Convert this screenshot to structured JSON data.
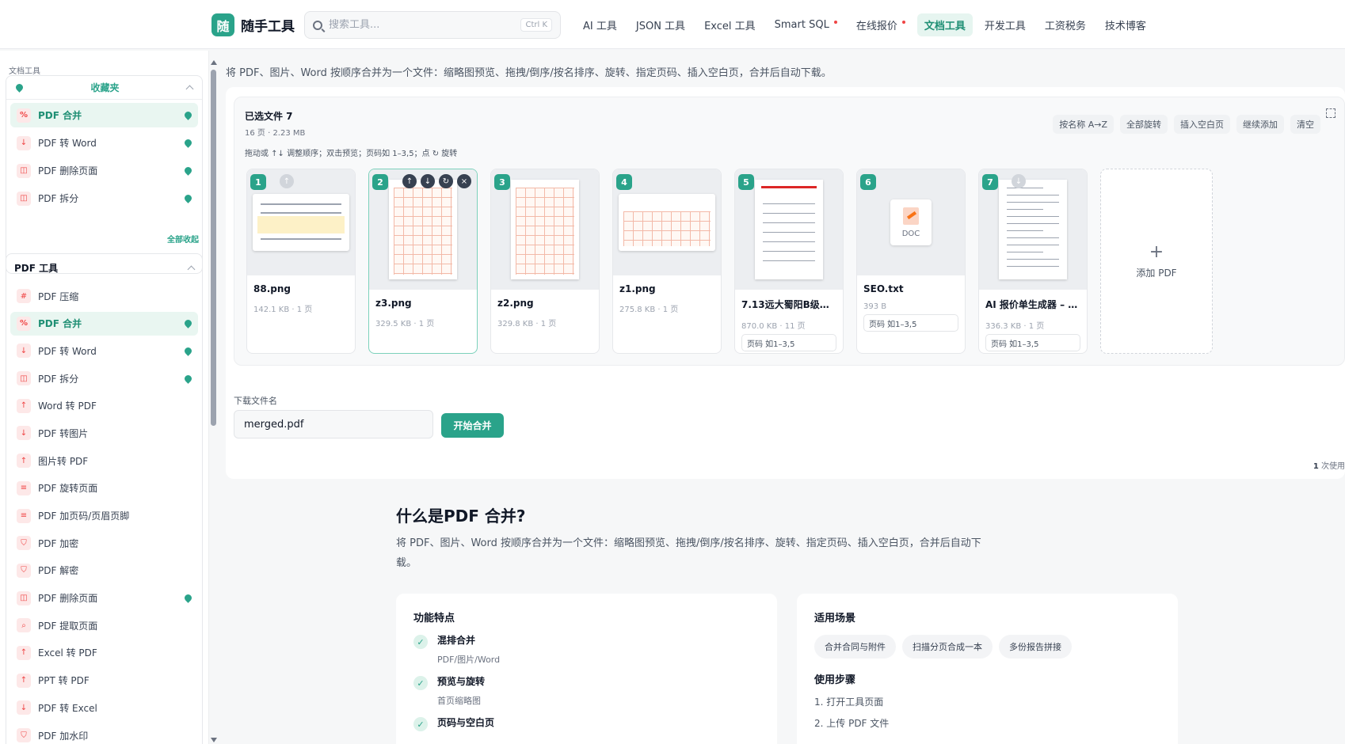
{
  "header": {
    "logo_mark": "随",
    "logo_text": "随手工具",
    "search_placeholder": "搜索工具...",
    "search_shortcut": "Ctrl K",
    "nav": [
      {
        "label": "AI 工具",
        "dot": false,
        "active": false
      },
      {
        "label": "JSON 工具",
        "dot": false,
        "active": false
      },
      {
        "label": "Excel 工具",
        "dot": false,
        "active": false
      },
      {
        "label": "Smart SQL",
        "dot": true,
        "active": false
      },
      {
        "label": "在线报价",
        "dot": true,
        "active": false
      },
      {
        "label": "文档工具",
        "dot": false,
        "active": true
      },
      {
        "label": "开发工具",
        "dot": false,
        "active": false
      },
      {
        "label": "工资税务",
        "dot": false,
        "active": false
      },
      {
        "label": "技术博客",
        "dot": false,
        "active": false
      }
    ]
  },
  "sidebar": {
    "caption": "文档工具",
    "favorites_title": "收藏夹",
    "favorites": [
      {
        "label": "PDF 合并",
        "icon": "merge-icon",
        "glyph": "%",
        "active": true
      },
      {
        "label": "PDF 转 Word",
        "icon": "download-icon",
        "glyph": "↓",
        "active": false
      },
      {
        "label": "PDF 删除页面",
        "icon": "pages-icon",
        "glyph": "◫",
        "active": false
      },
      {
        "label": "PDF 拆分",
        "icon": "pages-icon",
        "glyph": "◫",
        "active": false
      }
    ],
    "collapse_all": "全部收起",
    "tools_title": "PDF 工具",
    "tools": [
      {
        "label": "PDF 压缩",
        "icon": "hash-icon",
        "glyph": "#",
        "active": false,
        "pinned": false
      },
      {
        "label": "PDF 合并",
        "icon": "merge-icon",
        "glyph": "%",
        "active": true,
        "pinned": true
      },
      {
        "label": "PDF 转 Word",
        "icon": "download-icon",
        "glyph": "↓",
        "active": false,
        "pinned": true
      },
      {
        "label": "PDF 拆分",
        "icon": "pages-icon",
        "glyph": "◫",
        "active": false,
        "pinned": true
      },
      {
        "label": "Word 转 PDF",
        "icon": "upload-icon",
        "glyph": "↑",
        "active": false,
        "pinned": false
      },
      {
        "label": "PDF 转图片",
        "icon": "download-icon",
        "glyph": "↓",
        "active": false,
        "pinned": false
      },
      {
        "label": "图片转 PDF",
        "icon": "upload-icon",
        "glyph": "↑",
        "active": false,
        "pinned": false
      },
      {
        "label": "PDF 旋转页面",
        "icon": "lines-icon",
        "glyph": "≡",
        "active": false,
        "pinned": false
      },
      {
        "label": "PDF 加页码/页眉页脚",
        "icon": "lines-icon",
        "glyph": "≡",
        "active": false,
        "pinned": false
      },
      {
        "label": "PDF 加密",
        "icon": "shield-icon",
        "glyph": "⛉",
        "active": false,
        "pinned": false
      },
      {
        "label": "PDF 解密",
        "icon": "shield-icon",
        "glyph": "⛉",
        "active": false,
        "pinned": false
      },
      {
        "label": "PDF 删除页面",
        "icon": "pages-icon",
        "glyph": "◫",
        "active": false,
        "pinned": true
      },
      {
        "label": "PDF 提取页面",
        "icon": "search-icon",
        "glyph": "⌕",
        "active": false,
        "pinned": false
      },
      {
        "label": "Excel 转 PDF",
        "icon": "upload-icon",
        "glyph": "↑",
        "active": false,
        "pinned": false
      },
      {
        "label": "PPT 转 PDF",
        "icon": "upload-icon",
        "glyph": "↑",
        "active": false,
        "pinned": false
      },
      {
        "label": "PDF 转 Excel",
        "icon": "download-icon",
        "glyph": "↓",
        "active": false,
        "pinned": false
      },
      {
        "label": "PDF 加水印",
        "icon": "shield-icon",
        "glyph": "⛉",
        "active": false,
        "pinned": false
      }
    ]
  },
  "main": {
    "description": "将 PDF、图片、Word 按顺序合并为一个文件：缩略图预览、拖拽/倒序/按名排序、旋转、指定页码、插入空白页，合并后自动下载。",
    "files_title": "已选文件 7",
    "files_meta": "16 页 · 2.23 MB",
    "files_hint": "拖动或 ↑↓ 调整顺序；双击预览；页码如 1–3,5；点 ↻ 旋转",
    "actions": [
      "按名称 A→Z",
      "全部旋转",
      "插入空白页",
      "继续添加",
      "清空"
    ],
    "files": [
      {
        "index": "1",
        "name": "88.png",
        "meta": "142.1 KB · 1 页",
        "kind": "screenshot",
        "range": ""
      },
      {
        "index": "2",
        "name": "z3.png",
        "meta": "329.5 KB · 1 页",
        "kind": "grid",
        "range": ""
      },
      {
        "index": "3",
        "name": "z2.png",
        "meta": "329.8 KB · 1 页",
        "kind": "grid",
        "range": ""
      },
      {
        "index": "4",
        "name": "z1.png",
        "meta": "275.8 KB · 1 页",
        "kind": "wide-grid",
        "range": ""
      },
      {
        "index": "5",
        "name": "7.13远大蜀阳B级洁净…",
        "meta": "870.0 KB · 11 页",
        "kind": "report",
        "range": "页码 如1–3,5"
      },
      {
        "index": "6",
        "name": "SEO.txt",
        "meta": "393 B",
        "kind": "doc",
        "range": "页码 如1–3,5"
      },
      {
        "index": "7",
        "name": "AI 报价单生成器 – 免…",
        "meta": "336.3 KB · 1 页",
        "kind": "form",
        "range": "页码 如1–3,5"
      }
    ],
    "doc_label": "DOC",
    "card_controls": [
      "↑",
      "↓",
      "↻",
      "×"
    ],
    "add_pdf": "添加 PDF",
    "download_label": "下载文件名",
    "download_value": "merged.pdf",
    "merge_button": "开始合并",
    "usage_count": "1",
    "usage_suffix": "次使用"
  },
  "info": {
    "title": "什么是PDF 合并?",
    "description": "将 PDF、图片、Word 按顺序合并为一个文件：缩略图预览、拖拽/倒序/按名排序、旋转、指定页码、插入空白页，合并后自动下载。",
    "features_title": "功能特点",
    "features": [
      {
        "title": "混排合并",
        "desc": "PDF/图片/Word"
      },
      {
        "title": "预览与旋转",
        "desc": "首页缩略图"
      },
      {
        "title": "页码与空白页",
        "desc": ""
      }
    ],
    "scenes_title": "适用场景",
    "scenes": [
      "合并合同与附件",
      "扫描分页合成一本",
      "多份报告拼接"
    ],
    "steps_title": "使用步骤",
    "steps": [
      "1. 打开工具页面",
      "2. 上传 PDF 文件"
    ]
  },
  "colors": {
    "accent": "#2aa38a",
    "danger": "#ef4444"
  }
}
